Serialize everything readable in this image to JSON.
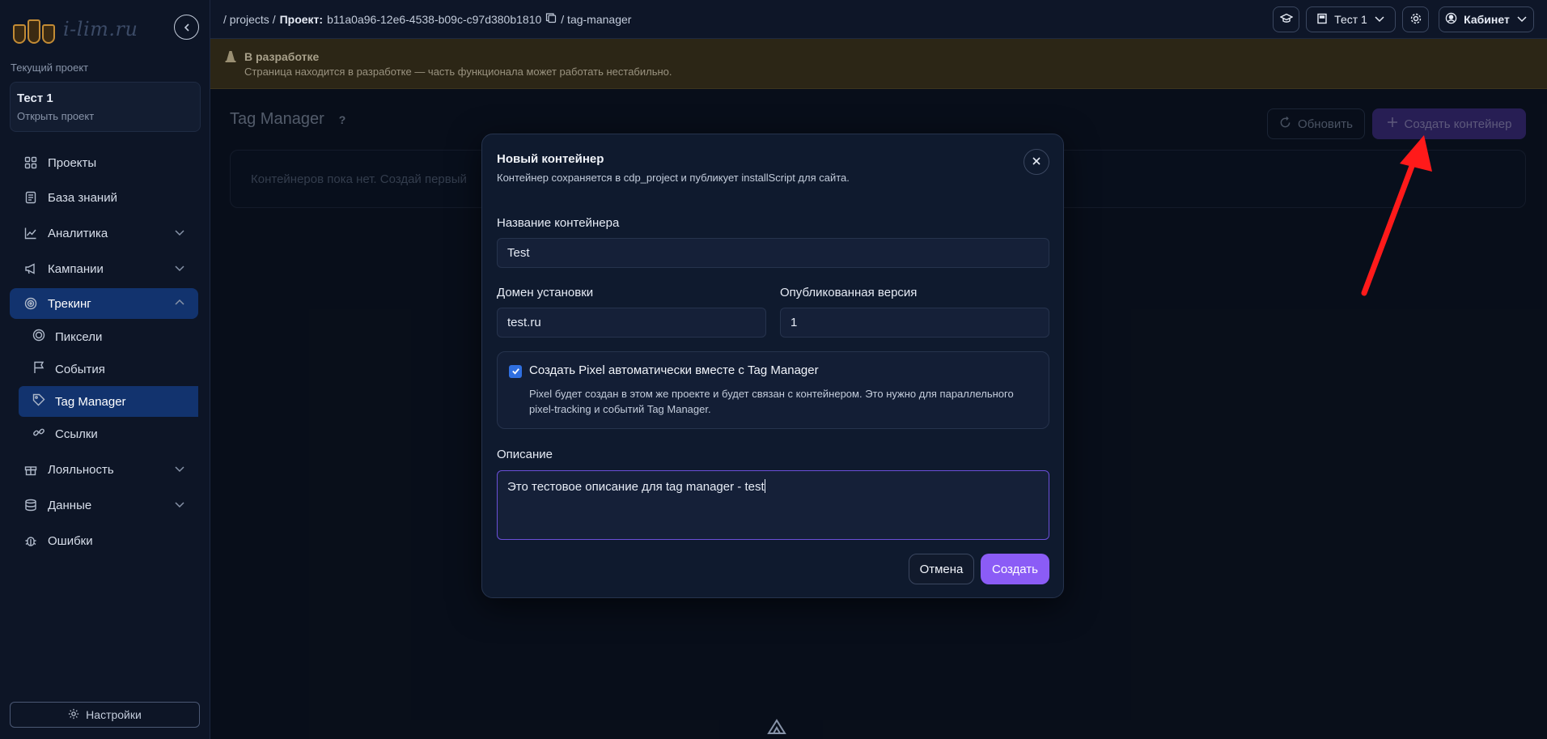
{
  "logo": {
    "text": "i-lim.ru"
  },
  "sidebar": {
    "current_project_label": "Текущий проект",
    "project": {
      "name": "Тест 1",
      "open_label": "Открыть проект"
    },
    "items": [
      {
        "label": "Проекты"
      },
      {
        "label": "База знаний"
      },
      {
        "label": "Аналитика"
      },
      {
        "label": "Кампании"
      },
      {
        "label": "Трекинг"
      },
      {
        "label": "Лояльность"
      },
      {
        "label": "Данные"
      },
      {
        "label": "Ошибки"
      }
    ],
    "tracking_sub": [
      {
        "label": "Пиксели"
      },
      {
        "label": "События"
      },
      {
        "label": "Tag Manager"
      },
      {
        "label": "Ссылки"
      }
    ],
    "settings_label": "Настройки"
  },
  "topbar": {
    "crumb_projects": "/ projects /",
    "crumb_project_label": "Проект:",
    "crumb_project_id": "b11a0a96-12e6-4538-b09c-c97d380b1810",
    "crumb_page": "/ tag-manager",
    "project_select": "Тест 1",
    "account_label": "Кабинет"
  },
  "banner": {
    "title": "В разработке",
    "text": "Страница находится в разработке — часть функционала может работать нестабильно."
  },
  "page": {
    "title": "Tag Manager",
    "help": "?",
    "refresh_label": "Обновить",
    "create_label": "Создать контейнер",
    "empty_text": "Контейнеров пока нет. Создай первый"
  },
  "modal": {
    "title": "Новый контейнер",
    "subtitle": "Контейнер сохраняется в cdp_project и публикует installScript для сайта.",
    "name_label": "Название контейнера",
    "name_value": "Test",
    "domain_label": "Домен установки",
    "domain_value": "test.ru",
    "version_label": "Опубликованная версия",
    "version_value": "1",
    "pixel_checkbox_label": "Создать Pixel автоматически вместе с Tag Manager",
    "pixel_checkbox_checked": true,
    "pixel_desc": "Pixel будет создан в этом же проекте и будет связан с контейнером. Это нужно для параллельного pixel-tracking и событий Tag Manager.",
    "desc_label": "Описание",
    "desc_value": "Это тестовое описание для tag manager - test",
    "cancel_label": "Отмена",
    "submit_label": "Создать"
  },
  "colors": {
    "accent": "#8b5cf6",
    "active_nav": "#12336e",
    "annotation_arrow": "#ff1a1a"
  }
}
